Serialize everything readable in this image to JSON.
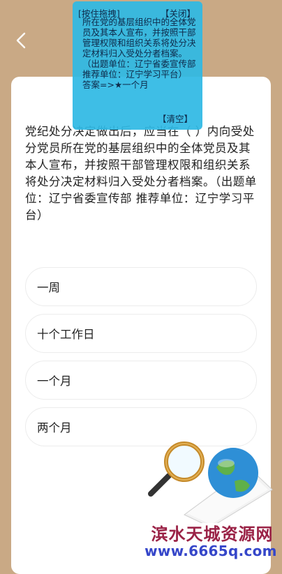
{
  "nav": {
    "back_icon": "chevron-left-icon"
  },
  "question": {
    "text": "党纪处分决定做出后，应当在（ ）内向受处分党员所在党的基层组织中的全体党员及其本人宣布，并按照干部管理权限和组织关系将处分决定材料归入受处分者档案。（出题单位：辽宁省委宣传部 推荐单位：辽宁学习平台）"
  },
  "options": [
    {
      "label": "一周"
    },
    {
      "label": "十个工作日"
    },
    {
      "label": "一个月"
    },
    {
      "label": "两个月"
    }
  ],
  "floating_panel": {
    "drag_label": "[按住拖拽]",
    "close_label": "【关闭】",
    "question_excerpt": "所在党的基层组织中的全体党员及其本人宣布，并按照干部管理权限和组织关系将处分决定材料归入受处分者档案。（出题单位：辽宁省委宣传部 推荐单位：辽宁学习平台）",
    "answer": "答案=>★一个月",
    "clear_label": "【清空】"
  },
  "watermark": {
    "line1": "滨水天城资源网",
    "line2": "www.6665q.com"
  },
  "colors": {
    "background": "#c9a985",
    "panel": "#2fb9e4",
    "watermark_red": "#9a2246",
    "watermark_blue": "#3546c9"
  }
}
